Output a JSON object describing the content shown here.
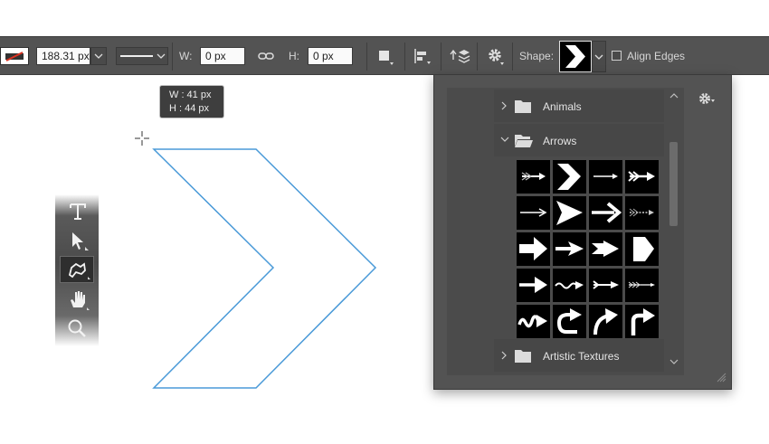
{
  "optbar": {
    "stroke_width": "188.31 px",
    "w_label": "W:",
    "w_value": "0 px",
    "h_label": "H:",
    "h_value": "0 px",
    "shape_label": "Shape:",
    "align_edges_label": "Align Edges",
    "align_edges_checked": false
  },
  "tooltip": {
    "w_text": "W : 41 px",
    "h_text": "H : 44 px"
  },
  "shape_panel": {
    "groups": [
      {
        "name": "Animals",
        "expanded": false
      },
      {
        "name": "Arrows",
        "expanded": true
      },
      {
        "name": "Artistic Textures",
        "expanded": false
      }
    ],
    "arrow_shapes": [
      "feather-arrow-shape",
      "chevron-arrow-shape",
      "thin-arrow-shape",
      "fletched-arrow-shape",
      "line-arrow-shape",
      "dart-arrow-shape",
      "bold-arrow-shape",
      "dashed-feather-arrow-shape",
      "block-arrow-shape",
      "pointer-arrow-shape",
      "barbed-arrow-shape",
      "pentagon-arrow-shape",
      "heavy-arrow-shape",
      "wave-arrow-shape",
      "split-arrow-shape",
      "long-fletched-arrow-shape",
      "squiggle-arrow-shape",
      "u-turn-arrow-shape",
      "curved-arrow-shape",
      "corner-arrow-shape"
    ]
  },
  "colors": {
    "shape_outline": "#4a9ad8",
    "panel_bg": "#535353",
    "optbar_bg": "#535353"
  }
}
